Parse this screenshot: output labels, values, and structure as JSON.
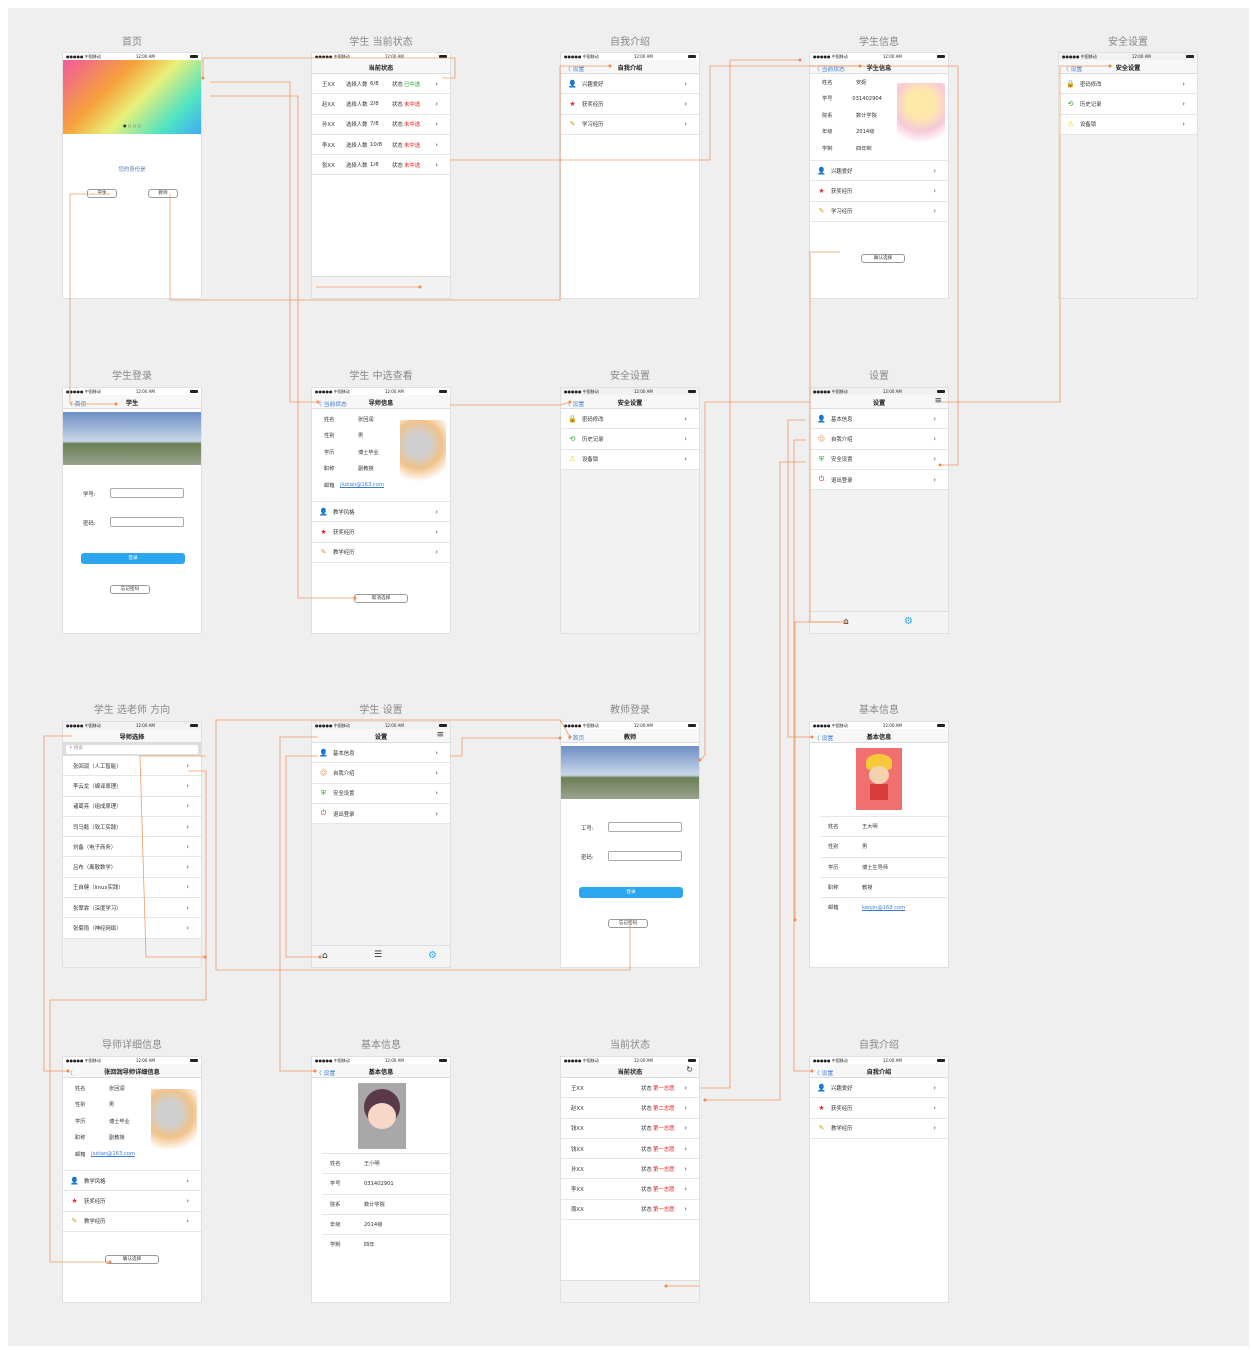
{
  "titles": {
    "s1": "首页",
    "s2": "学生 当前状态",
    "s3": "自我介绍",
    "s4": "学生信息",
    "s5": "安全设置",
    "s6": "学生登录",
    "s7": "学生 中选查看",
    "s8": "安全设置",
    "s9": "设置",
    "s10": "学生 选老师 方向",
    "s11": "学生 设置",
    "s12": "教师登录",
    "s13": "基本信息",
    "s14": "导师详细信息",
    "s15": "基本信息",
    "s16": "当前状态",
    "s17": "自我介绍"
  },
  "status": {
    "carrier": "●●●●● 中国移动",
    "time": "12:00 AM"
  },
  "home": {
    "question": "您的身份是",
    "student": "学生",
    "teacher": "教师",
    "dots": "● ○ ○ ○"
  },
  "state": {
    "title": "当前状态",
    "count_label": "选择人数",
    "state_label": "状态",
    "rows": [
      {
        "name": "王XX",
        "count": "6/8",
        "state": "已中选"
      },
      {
        "name": "赵XX",
        "count": "2/8",
        "state": "未中选"
      },
      {
        "name": "孙XX",
        "count": "7/8",
        "state": "未中选"
      },
      {
        "name": "李XX",
        "count": "10/8",
        "state": "未中选"
      },
      {
        "name": "张XX",
        "count": "1/8",
        "state": "未中选"
      }
    ]
  },
  "intro": {
    "back": "设置",
    "title": "自我介绍",
    "items": [
      "兴趣爱好",
      "获奖经历",
      "学习经历"
    ]
  },
  "stuinfo": {
    "back": "当前状态",
    "title": "学生信息",
    "fields": [
      {
        "k": "姓名",
        "v": "安妮"
      },
      {
        "k": "学号",
        "v": "031402904"
      },
      {
        "k": "院系",
        "v": "数计学院"
      },
      {
        "k": "年级",
        "v": "2014级"
      },
      {
        "k": "学制",
        "v": "四年制"
      }
    ],
    "items": [
      "兴趣爱好",
      "获奖经历",
      "学习经历"
    ],
    "confirm": "确认选择"
  },
  "security": {
    "back": "设置",
    "title": "安全设置",
    "items": [
      "密码修改",
      "历史记录",
      "设备锁"
    ]
  },
  "login": {
    "back": "首页",
    "title": "学生",
    "id_label": "学号:",
    "pw_label": "密码:",
    "login": "登录",
    "forgot": "忘记密码"
  },
  "tinfo": {
    "back": "当前状态",
    "title": "导师信息",
    "fields": [
      {
        "k": "姓名",
        "v": "张回润"
      },
      {
        "k": "性别",
        "v": "男"
      },
      {
        "k": "学历",
        "v": "博士毕业"
      },
      {
        "k": "职称",
        "v": "副教授"
      },
      {
        "k": "邮箱",
        "v": "jiutian@163.com"
      }
    ],
    "items": [
      "教学风格",
      "获奖经历",
      "教学经历"
    ],
    "cancel": "取消选择"
  },
  "settings": {
    "title": "设置",
    "items": [
      "基本信息",
      "自我介绍",
      "安全设置",
      "退出登录"
    ]
  },
  "choose": {
    "title": "导师选择",
    "search": "搜索",
    "teachers": [
      "张回润（人工智能）",
      "李云龙（编译原理）",
      "诸葛亮（组成原理）",
      "司马懿（软工实践）",
      "刘备（电子商务）",
      "吕布（离散数学）",
      "王自健（linux实践）",
      "张翠霏（深度学习）",
      "张菊雨（神经网络）"
    ]
  },
  "tlogin": {
    "back": "首页",
    "title": "教师",
    "id_label": "工号:",
    "pw_label": "密码:",
    "login": "登录",
    "forgot": "忘记密码"
  },
  "basic_t": {
    "back": "设置",
    "title": "基本信息",
    "fields": [
      {
        "k": "姓名",
        "v": "王大明"
      },
      {
        "k": "性别",
        "v": "男"
      },
      {
        "k": "学历",
        "v": "博士生导师"
      },
      {
        "k": "职称",
        "v": "教授"
      },
      {
        "k": "邮箱",
        "v": "kenjin@163.com"
      }
    ]
  },
  "tdetail": {
    "title": "张回润导师详细信息",
    "fields": [
      {
        "k": "姓名",
        "v": "张回润"
      },
      {
        "k": "性别",
        "v": "男"
      },
      {
        "k": "学历",
        "v": "博士毕业"
      },
      {
        "k": "职称",
        "v": "副教授"
      },
      {
        "k": "邮箱",
        "v": "jiutian@163.com"
      }
    ],
    "items": [
      "教学风格",
      "获奖经历",
      "教学经历"
    ],
    "confirm": "确认选择"
  },
  "basic_s": {
    "back": "设置",
    "title": "基本信息",
    "fields": [
      {
        "k": "姓名",
        "v": "王小明"
      },
      {
        "k": "学号",
        "v": "031402901"
      },
      {
        "k": "院系",
        "v": "数计学院"
      },
      {
        "k": "年级",
        "v": "2014级"
      },
      {
        "k": "学制",
        "v": "四年"
      }
    ]
  },
  "tstate": {
    "title": "当前状态",
    "state_label": "状态",
    "rows": [
      {
        "name": "王XX",
        "state": "第一志愿"
      },
      {
        "name": "赵XX",
        "state": "第二志愿"
      },
      {
        "name": "钱XX",
        "state": "第一志愿"
      },
      {
        "name": "钱XX",
        "state": "第一志愿"
      },
      {
        "name": "孙XX",
        "state": "第一志愿"
      },
      {
        "name": "李XX",
        "state": "第一志愿"
      },
      {
        "name": "周XX",
        "state": "第一志愿"
      }
    ]
  },
  "tintro": {
    "back": "设置",
    "title": "自我介绍",
    "items": [
      "兴趣爱好",
      "获奖经历",
      "教学经历"
    ]
  },
  "colors": {
    "accent": "#2ba6ef",
    "link": "#f08a4b",
    "back": "#3a7bd5"
  }
}
